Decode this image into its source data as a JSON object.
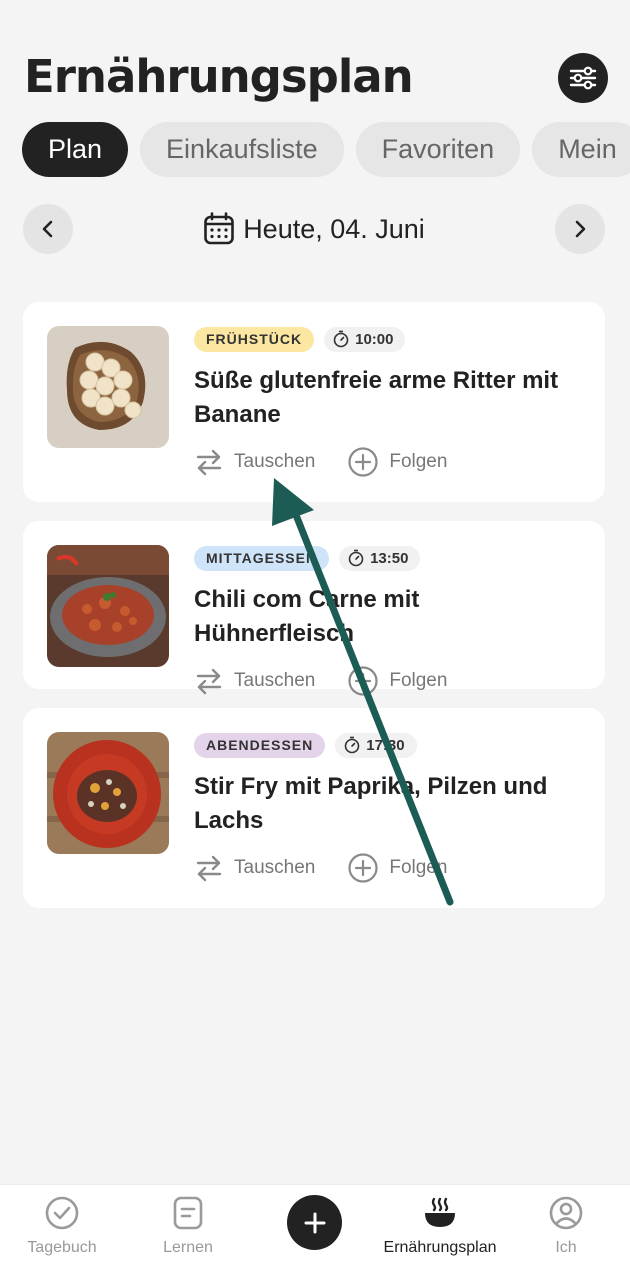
{
  "header": {
    "title": "Ernährungsplan",
    "filter_icon": "sliders-icon"
  },
  "tabs": [
    {
      "label": "Plan",
      "active": true
    },
    {
      "label": "Einkaufsliste",
      "active": false
    },
    {
      "label": "Favoriten",
      "active": false
    },
    {
      "label": "Mein",
      "active": false
    }
  ],
  "date": {
    "label": "Heute, 04. Juni"
  },
  "meals": [
    {
      "tag": "FRÜHSTÜCK",
      "tag_color": "#fbe7a1",
      "time": "10:00",
      "title": "Süße glutenfreie arme Ritter mit Banane",
      "swap_label": "Tauschen",
      "follow_label": "Folgen"
    },
    {
      "tag": "MITTAGESSEN",
      "tag_color": "#cfe4f8",
      "time": "13:50",
      "title": "Chili com Carne mit Hühnerfleisch",
      "swap_label": "Tauschen",
      "follow_label": "Folgen"
    },
    {
      "tag": "ABENDESSEN",
      "tag_color": "#e4d4ea",
      "time": "17:30",
      "title": "Stir Fry mit Paprika, Pilzen und Lachs",
      "swap_label": "Tauschen",
      "follow_label": "Folgen"
    }
  ],
  "nav": {
    "items": [
      {
        "label": "Tagebuch",
        "icon": "check-circle-icon"
      },
      {
        "label": "Lernen",
        "icon": "document-icon"
      },
      {
        "label": "Ernährungsplan",
        "icon": "bowl-icon",
        "active": true
      },
      {
        "label": "Ich",
        "icon": "profile-icon"
      }
    ],
    "add_icon": "plus-icon"
  },
  "colors": {
    "accent": "#222222",
    "background": "#f4f4f4",
    "annotation_arrow": "#1d5c55"
  }
}
